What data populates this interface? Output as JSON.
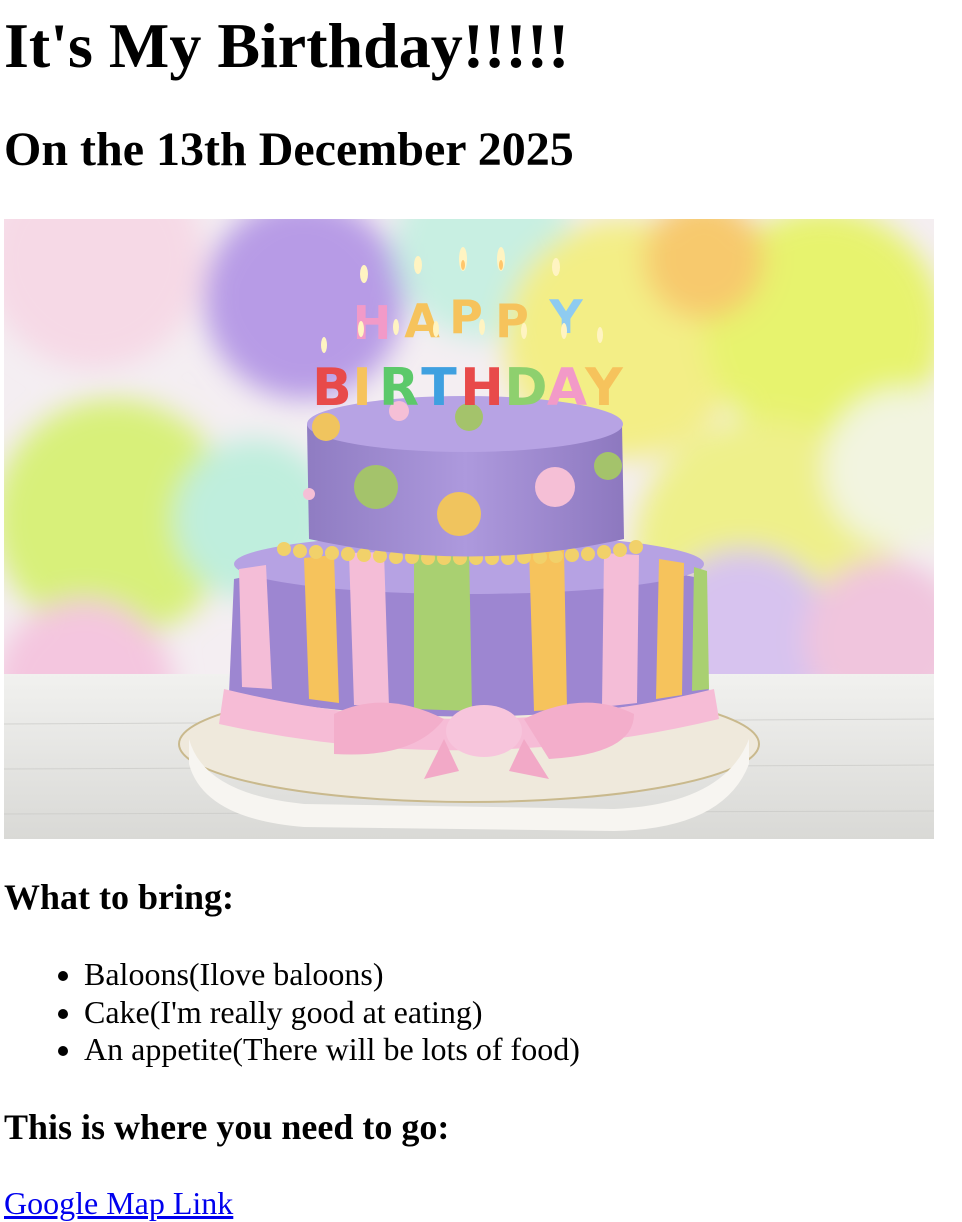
{
  "page": {
    "title": "It's My Birthday!!!!!",
    "subtitle": "On the 13th December 2025"
  },
  "image": {
    "alt": "Birthday cake",
    "icon": "birthday-cake-image",
    "candle_letters_top": "HAPPY",
    "candle_letters_bottom": "BIRTHDAY"
  },
  "bring": {
    "heading": "What to bring:",
    "items": [
      "Baloons(Ilove baloons)",
      "Cake(I'm really good at eating)",
      "An appetite(There will be lots of food)"
    ]
  },
  "location": {
    "heading": "This is where you need to go:",
    "link_text": "Google Map Link"
  },
  "colors": {
    "link": "#0000ee",
    "text": "#000000"
  }
}
